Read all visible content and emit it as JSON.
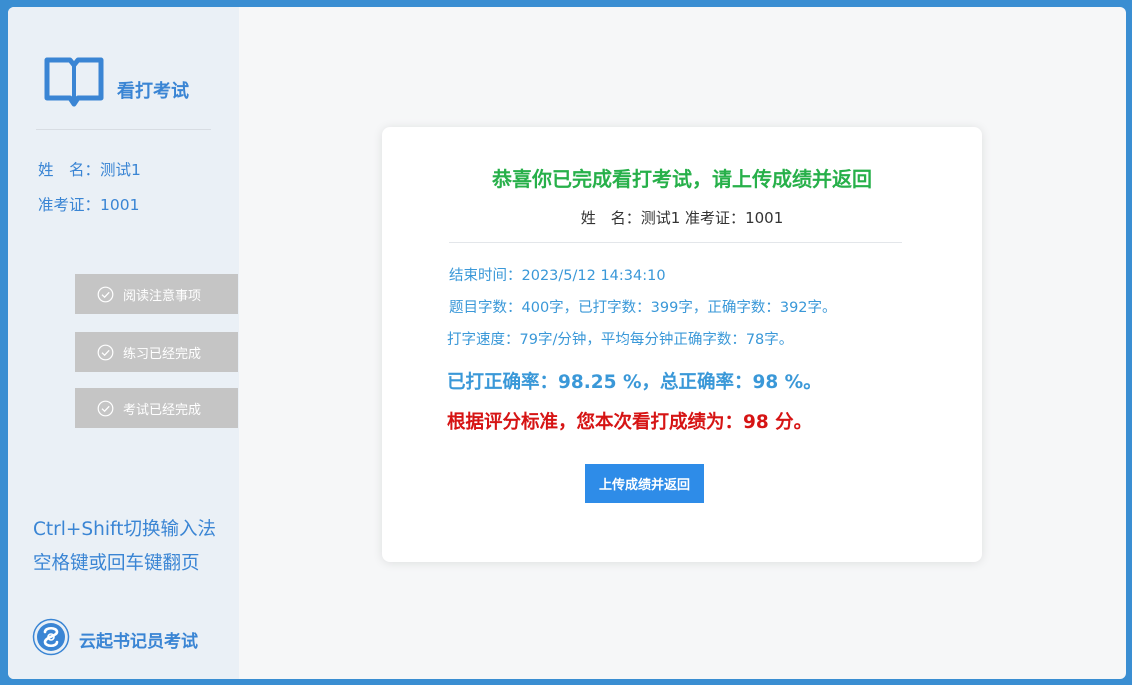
{
  "app": {
    "logo_title": "看打考试",
    "brand_name": "云起书记员考试"
  },
  "candidate": {
    "name_label": "姓　名：",
    "name_value": "测试1",
    "id_label": "准考证：",
    "id_value": "1001"
  },
  "steps": [
    {
      "label": "阅读注意事项"
    },
    {
      "label": "练习已经完成"
    },
    {
      "label": "考试已经完成"
    }
  ],
  "hints": {
    "line1": "Ctrl+Shift切换输入法",
    "line2": "空格键或回车键翻页"
  },
  "result": {
    "title": "恭喜你已完成看打考试，请上传成绩并返回",
    "subtitle": "姓　名：测试1 准考证：1001",
    "end_time": "结束时间：2023/5/12 14:34:10",
    "counts": "题目字数：400字，已打字数：399字，正确字数：392字。",
    "speed": "打字速度：79字/分钟，平均每分钟正确字数：78字。",
    "accuracy": "已打正确率：98.25 %，总正确率：98 %。",
    "score": "根据评分标准，您本次看打成绩为：98 分。",
    "upload_button": "上传成绩并返回"
  },
  "colors": {
    "accent": "#3a85d4",
    "title_green": "#27b04a",
    "score_red": "#d61414",
    "button_blue": "#2e8ce8",
    "step_gray": "#c5c5c5"
  }
}
